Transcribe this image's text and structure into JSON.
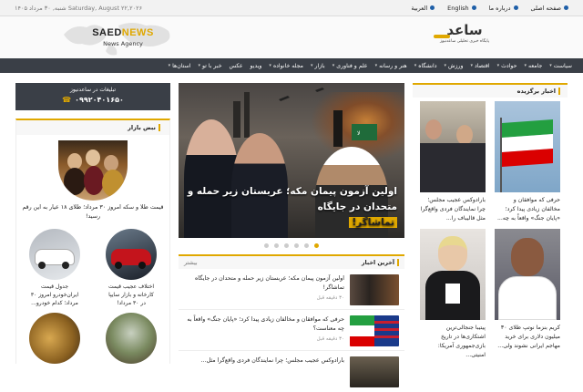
{
  "topbar": {
    "links": [
      {
        "label": "صفحه اصلی",
        "icon": "home-icon"
      },
      {
        "label": "درباره ما",
        "icon": "info-icon"
      },
      {
        "label": "English",
        "icon": "globe-icon"
      },
      {
        "label": "العربية",
        "icon": "globe-icon"
      }
    ],
    "date": "شنبه, ۳۰ مرداد ۱۴۰۵ Saturday, August ۲۲,۲۰۲۶"
  },
  "header": {
    "left_logo": {
      "brand_a": "SAED",
      "brand_b": "NEWS",
      "tagline": "News Agency"
    },
    "right_logo": {
      "name": "ساعد",
      "tagline": "پایگاه خبری تحلیلی ساعدنیوز"
    }
  },
  "nav": {
    "items": [
      "سیاست",
      "جامعه",
      "حوادث",
      "اقتصاد",
      "ورزش",
      "دانشگاه",
      "هنر و رسانه",
      "علم و فناوری",
      "بازار",
      "مجله خانواده",
      "ویدیو",
      "عکس",
      "خبر با تو",
      "استان‌ها"
    ]
  },
  "ad": {
    "title": "تبلیغات در ساعدنیوز",
    "phone": "۰۹۹۲۰۴۰۱۶۵۰"
  },
  "market": {
    "heading": "نبض بازار",
    "top_caption": "قیمت طلا و سکه امروز ۳۰ مرداد؛ طلای ۱۸ عیار به این رقم رسید!",
    "cards": [
      {
        "caption": "جدول قیمت ایران‌خودرو امروز ۳۰ مرداد؛ کدام خودرو..."
      },
      {
        "caption": "اختلاف عجیب قیمت کارخانه و بازار سایپا در ۳۰ مرداد!"
      }
    ]
  },
  "slider": {
    "title_line1": "اولین آزمون پیمان مکه؛ عربستان زیر حمله و متحدان در جایگاه",
    "title_line2": "تماشاگر!",
    "dot_count": 6,
    "active_dot": 5
  },
  "latest": {
    "heading": "آخرین اخبار",
    "more": "بیشتر",
    "items": [
      {
        "text": "اولین آزمون پیمان مکه؛ عربستان زیر حمله و متحدان در جایگاه تماشاگر!",
        "time": "۳۰ دقیقه قبل"
      },
      {
        "text": "حرفی که موافقان و مخالفان زیادی پیدا کرد؛ «پایان جنگ» واقعاً به چه معناست؟",
        "time": "۳۰ دقیقه قبل"
      },
      {
        "text": "بارادوکس عجیب مجلس؛ چرا نمایندگان فردی واقع‌گرا مثل...",
        "time": ""
      }
    ]
  },
  "featured": {
    "heading": "اخبار برگزیده",
    "cards": [
      {
        "text": "حرفی که موافقان و مخالفان زیادی پیدا کرد؛ «پایان جنگ» واقعاً به چه..."
      },
      {
        "text": "بارادوکس عجیب مجلس؛ چرا نمایندگان فردی واقع‌گرا مثل قالیباف را..."
      },
      {
        "text": "کریم بنزما نوتپ طلای ۳۰ میلیون دلاری برای خرید مهاجم ایرانی نشوند ولی..."
      },
      {
        "text": "پیتیبا جنجالی‌ترین اشتکاری‌ها در تاریخ بازی‌جمهوری آمریکا: امنیتی..."
      }
    ]
  }
}
